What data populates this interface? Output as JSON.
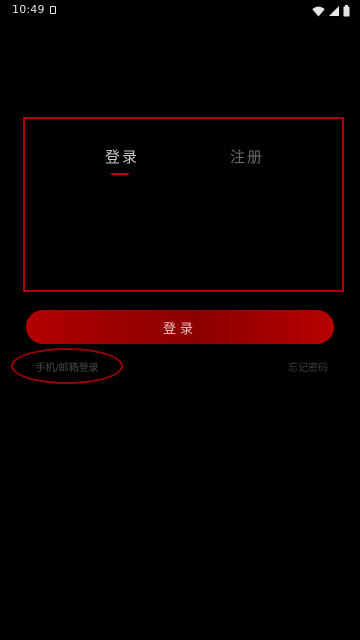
{
  "status_bar": {
    "time": "10:49",
    "icons": [
      "notification-icon",
      "wifi-icon",
      "signal-icon",
      "battery-icon"
    ]
  },
  "auth": {
    "tabs": [
      {
        "label": "登录",
        "active": true
      },
      {
        "label": "注册",
        "active": false
      }
    ]
  },
  "actions": {
    "login_button": "登录",
    "verify_login_link": "手机/邮箱登录",
    "forgot_password_link": "忘记密码"
  },
  "colors": {
    "background": "#000000",
    "accent": "#b10000",
    "tab_active": "#c9c9c9",
    "tab_inactive": "#6a6a6a",
    "link_text": "#4a4a4a"
  }
}
